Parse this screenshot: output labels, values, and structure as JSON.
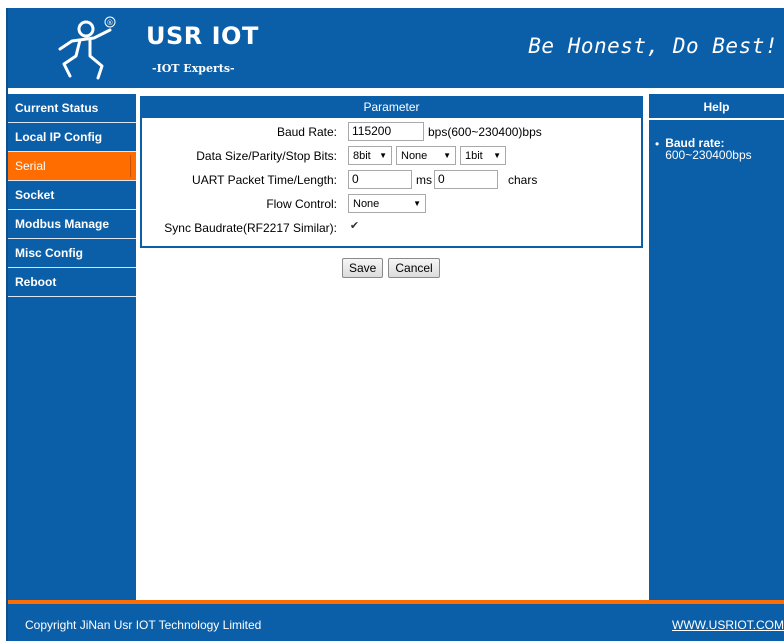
{
  "header": {
    "brand_title": "USR IOT",
    "brand_subtitle": "-IOT Experts-",
    "slogan": "Be Honest, Do Best!",
    "logo_mark": "®"
  },
  "sidebar": {
    "items": [
      {
        "label": "Current Status"
      },
      {
        "label": "Local IP Config"
      },
      {
        "label": "Serial",
        "active": true
      },
      {
        "label": "Socket"
      },
      {
        "label": "Modbus Manage"
      },
      {
        "label": "Misc Config"
      },
      {
        "label": "Reboot"
      }
    ]
  },
  "parameter": {
    "title": "Parameter",
    "baud_rate": {
      "label": "Baud Rate:",
      "value": "115200",
      "hint": "bps(600~230400)bps"
    },
    "data_size": {
      "label": "Data Size/Parity/Stop Bits:",
      "data_bits": "8bit",
      "parity": "None",
      "stop_bits": "1bit"
    },
    "packet": {
      "label": "UART Packet Time/Length:",
      "time_value": "0",
      "time_unit": "ms",
      "length_value": "0",
      "length_unit": "chars"
    },
    "flow_control": {
      "label": "Flow Control:",
      "value": "None"
    },
    "sync_baudrate": {
      "label": "Sync Baudrate(RF2217 Similar):",
      "checked": true,
      "mark": "✔"
    },
    "dropdown_arrow": "▼"
  },
  "buttons": {
    "save": "Save",
    "cancel": "Cancel"
  },
  "help": {
    "title": "Help",
    "bullet": "•",
    "items": [
      {
        "term": "Baud rate:",
        "desc": "600~230400bps"
      }
    ]
  },
  "footer": {
    "copyright": "Copyright JiNan Usr IOT Technology Limited",
    "website": "WWW.USRIOT.COM"
  },
  "colors": {
    "brand_blue": "#0b5ea8",
    "accent_orange": "#ff6d00"
  }
}
